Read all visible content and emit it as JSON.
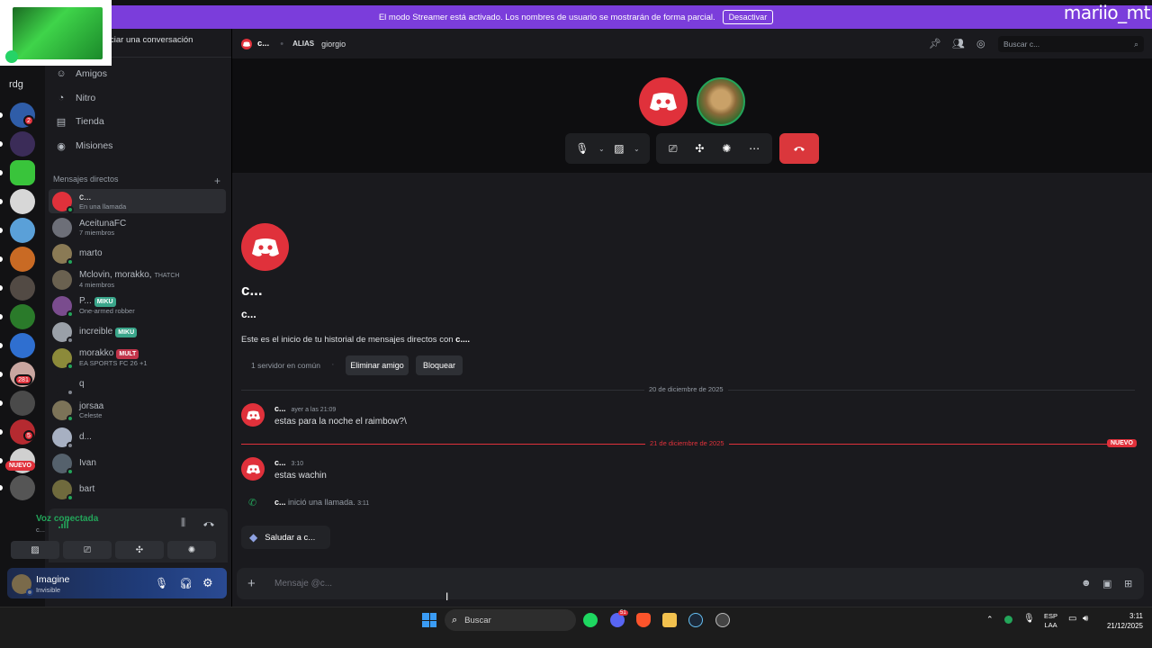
{
  "overlay": {
    "streamer_name": "mariio_mt"
  },
  "banner": {
    "message": "El modo Streamer está activado. Los nombres de usuario se mostrarán de forma parcial.",
    "button": "Desactivar"
  },
  "rail": {
    "label": "rdg",
    "badges": [
      "2",
      "281",
      "5"
    ],
    "new_tag": "NUEVO"
  },
  "sidebar": {
    "search_placeholder": "Iniciar una conversación",
    "nav": [
      {
        "label": "Amigos",
        "icon": "friends-icon"
      },
      {
        "label": "Nitro",
        "icon": "nitro-icon"
      },
      {
        "label": "Tienda",
        "icon": "shop-icon"
      },
      {
        "label": "Misiones",
        "icon": "quests-icon"
      }
    ],
    "dm_header": "Mensajes directos",
    "dms": [
      {
        "name": "c...",
        "sub": "En una llamada",
        "color": "#e0313b",
        "status": "#23a55a",
        "active": true
      },
      {
        "name": "AceitunaFC",
        "sub": "7 miembros",
        "color": "#6d6f78",
        "status": ""
      },
      {
        "name": "marto",
        "sub": "",
        "color": "#8a7a55",
        "status": "#23a55a"
      },
      {
        "name": "Mclovin, morakko,",
        "extra": "THATCH",
        "sub": "4 miembros",
        "color": "#6a6150",
        "status": ""
      },
      {
        "name": "P...",
        "tag": "MIKU",
        "tag_color": "#3aa58a",
        "sub": "One-armed robber",
        "color": "#7a4c8e",
        "status": "#23a55a"
      },
      {
        "name": "increible",
        "tag": "MIKU",
        "tag_color": "#3aa58a",
        "sub": "",
        "color": "#9aa0a8",
        "status": "#80848e"
      },
      {
        "name": "morakko",
        "tag": "MULT",
        "tag_color": "#c2344a",
        "sub": "EA SPORTS FC 26 +1",
        "color": "#8c8a3a",
        "status": "#23a55a"
      },
      {
        "name": "q",
        "sub": "",
        "color": "#1a1a1e",
        "status": "#80848e"
      },
      {
        "name": "jorsaa",
        "sub": "Celeste",
        "color": "#7c7358",
        "status": "#23a55a"
      },
      {
        "name": "d...",
        "sub": "",
        "color": "#a7b0c2",
        "status": "#80848e"
      },
      {
        "name": "Ivan",
        "sub": "",
        "color": "#55616c",
        "status": "#23a55a"
      },
      {
        "name": "bart",
        "sub": "",
        "color": "#6f6a3d",
        "status": "#23a55a"
      }
    ],
    "voice": {
      "title": "Voz conectada",
      "channel": "c..."
    },
    "user": {
      "name": "Imagine",
      "status": "Invisible"
    }
  },
  "topbar": {
    "name": "c...",
    "alias_label": "ALIAS",
    "alias_value": "giorgio",
    "search_placeholder": "Buscar c..."
  },
  "chat": {
    "big_name": "c...",
    "small_name": "c...",
    "intro_prefix": "Este es el inicio de tu historial de mensajes directos con ",
    "intro_name": "c....",
    "mutual": "1 servidor en común",
    "remove_friend": "Eliminar amigo",
    "block": "Bloquear",
    "date1": "20 de diciembre de 2025",
    "date2": "21 de diciembre de 2025",
    "new_label": "NUEVO",
    "messages": [
      {
        "author": "c...",
        "time": "ayer a las 21:09",
        "text": "estas para la noche el raimbow?\\"
      },
      {
        "author": "c...",
        "time": "3:10",
        "text": "estas wachin"
      }
    ],
    "call_author": "c...",
    "call_text": "inició una llamada.",
    "call_time": "3:11",
    "wave_button": "Saludar a c...",
    "input_placeholder": "Mensaje @c..."
  },
  "taskbar": {
    "search": "Buscar",
    "lang_top": "ESP",
    "lang_bottom": "LAA",
    "time": "3:11",
    "date": "21/12/2025",
    "discord_badge": "51"
  }
}
